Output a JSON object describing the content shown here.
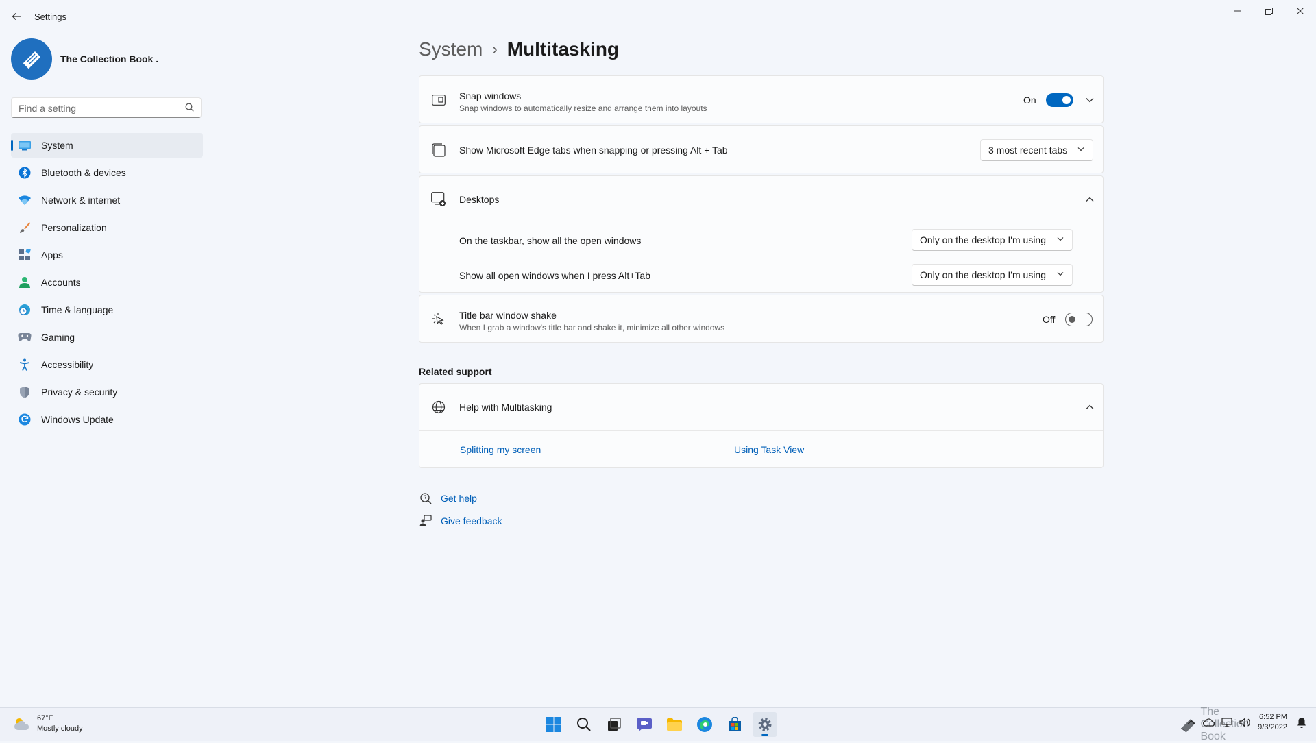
{
  "window": {
    "title": "Settings",
    "minimize_glyph": "—",
    "maximize_glyph": "❐",
    "close_glyph": "✕"
  },
  "profile": {
    "name": "The Collection Book ."
  },
  "search": {
    "placeholder": "Find a setting"
  },
  "nav": {
    "items": [
      {
        "label": "System",
        "icon": "monitor-icon",
        "active": true
      },
      {
        "label": "Bluetooth & devices",
        "icon": "bluetooth-icon"
      },
      {
        "label": "Network & internet",
        "icon": "wifi-icon"
      },
      {
        "label": "Personalization",
        "icon": "brush-icon"
      },
      {
        "label": "Apps",
        "icon": "apps-icon"
      },
      {
        "label": "Accounts",
        "icon": "person-icon"
      },
      {
        "label": "Time & language",
        "icon": "clock-globe-icon"
      },
      {
        "label": "Gaming",
        "icon": "gamepad-icon"
      },
      {
        "label": "Accessibility",
        "icon": "accessibility-icon"
      },
      {
        "label": "Privacy & security",
        "icon": "shield-icon"
      },
      {
        "label": "Windows Update",
        "icon": "refresh-icon"
      }
    ]
  },
  "breadcrumb": {
    "root": "System",
    "separator": "›",
    "current": "Multitasking"
  },
  "snap": {
    "title": "Snap windows",
    "subtitle": "Snap windows to automatically resize and arrange them into layouts",
    "state": "On"
  },
  "edge_tabs": {
    "title": "Show Microsoft Edge tabs when snapping or pressing Alt + Tab",
    "value": "3 most recent tabs"
  },
  "desktops": {
    "title": "Desktops",
    "taskbar_label": "On the taskbar, show all the open windows",
    "taskbar_value": "Only on the desktop I'm using",
    "alttab_label": "Show all open windows when I press Alt+Tab",
    "alttab_value": "Only on the desktop I'm using"
  },
  "shake": {
    "title": "Title bar window shake",
    "subtitle": "When I grab a window's title bar and shake it, minimize all other windows",
    "state": "Off"
  },
  "related": {
    "heading": "Related support",
    "help_title": "Help with Multitasking",
    "link1": "Splitting my screen",
    "link2": "Using Task View"
  },
  "footer": {
    "get_help": "Get help",
    "give_feedback": "Give feedback"
  },
  "taskbar": {
    "weather_temp": "67°F",
    "weather_desc": "Mostly cloudy",
    "time": "6:52 PM",
    "date": "9/3/2022",
    "watermark": "The Collection Book"
  },
  "colors": {
    "accent": "#0067c0",
    "link": "#005fb8",
    "background": "#f3f6fb"
  }
}
